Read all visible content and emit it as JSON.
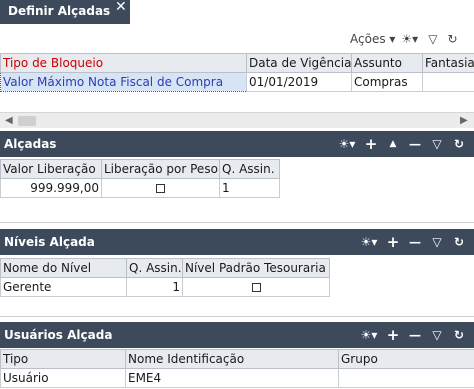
{
  "tab": {
    "title": "Definir Alçadas",
    "close": "✕"
  },
  "toolbar": {
    "actions_label": "Ações ▾"
  },
  "main_grid": {
    "headers": [
      "Tipo de Bloqueio",
      "Data de Vigência",
      "Assunto",
      "Fantasia"
    ],
    "row": [
      "Valor Máximo Nota Fiscal de Compra",
      "01/01/2019",
      "Compras",
      ""
    ]
  },
  "alcadas": {
    "title": "Alçadas",
    "headers": [
      "Valor Liberação",
      "Liberação por Peso",
      "Q. Assin."
    ],
    "row": {
      "valor": "999.999,00",
      "qassin": "1"
    }
  },
  "niveis": {
    "title": "Níveis Alçada",
    "headers": [
      "Nome do Nível",
      "Q. Assin.",
      "Nível Padrão Tesouraria"
    ],
    "row": {
      "nome": "Gerente",
      "qassin": "1"
    }
  },
  "usuarios": {
    "title": "Usuários Alçada",
    "headers": [
      "Tipo",
      "Nome Identificação",
      "Grupo"
    ],
    "row": {
      "tipo": "Usuário",
      "nome": "EME4",
      "grupo": ""
    }
  },
  "icons": {
    "columns": "☀▾",
    "add": "+",
    "up": "▲",
    "remove": "—",
    "filter": "▽",
    "refresh": "↻"
  },
  "colors": {
    "header_bg": "#3d4a5c",
    "selected_row": "#d7e4f5",
    "highlight_text": "#cc0000",
    "link_text": "#2a3fb0"
  }
}
